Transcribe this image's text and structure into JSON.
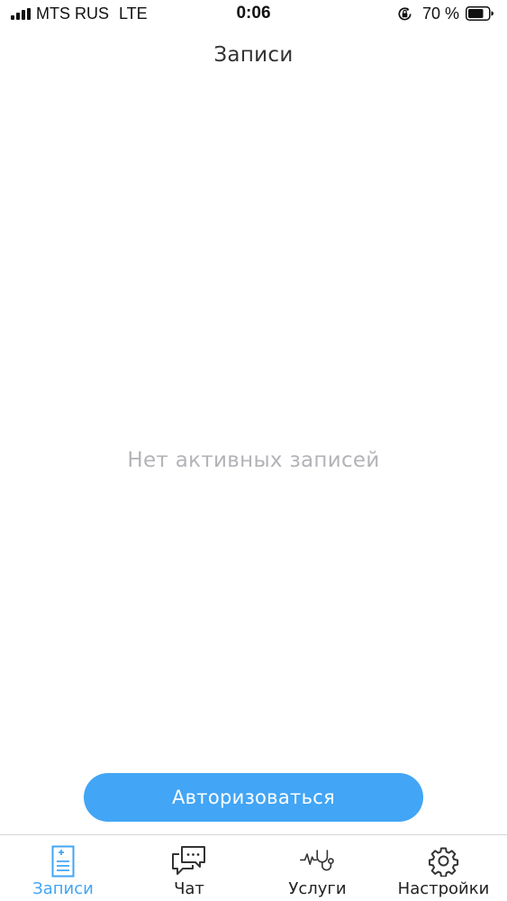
{
  "status_bar": {
    "carrier": "MTS RUS",
    "network": "LTE",
    "time": "0:06",
    "battery_percent": "70 %"
  },
  "nav": {
    "title": "Записи"
  },
  "empty_state": {
    "message": "Нет активных записей"
  },
  "auth_button": {
    "label": "Авторизоваться"
  },
  "tab_bar": {
    "items": [
      {
        "label": "Записи",
        "icon": "records-icon",
        "active": true
      },
      {
        "label": "Чат",
        "icon": "chat-icon",
        "active": false
      },
      {
        "label": "Услуги",
        "icon": "stethoscope-icon",
        "active": false
      },
      {
        "label": "Настройки",
        "icon": "gear-icon",
        "active": false
      }
    ]
  },
  "colors": {
    "accent": "#42a5f5",
    "placeholder_text": "#b3b3b8",
    "title_text": "#333333"
  }
}
